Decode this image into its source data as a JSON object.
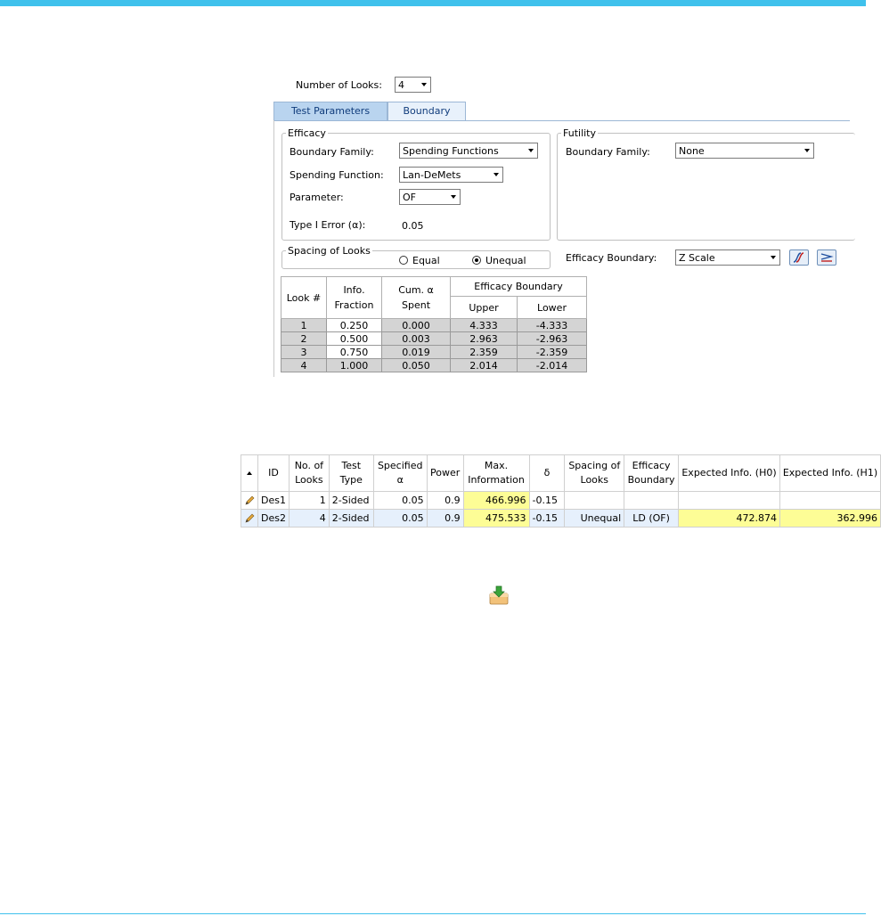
{
  "looks": {
    "label": "Number of Looks:",
    "value": "4"
  },
  "tabs": [
    {
      "label": "Test Parameters"
    },
    {
      "label": "Boundary"
    }
  ],
  "efficacy": {
    "group_label": "Efficacy",
    "boundary_family_label": "Boundary Family:",
    "boundary_family_value": "Spending Functions",
    "spending_function_label": "Spending Function:",
    "spending_function_value": "Lan-DeMets",
    "parameter_label": "Parameter:",
    "parameter_value": "OF",
    "type1_label": "Type I Error (α):",
    "type1_value": "0.05"
  },
  "futility": {
    "group_label": "Futility",
    "boundary_family_label": "Boundary Family:",
    "boundary_family_value": "None"
  },
  "spacing": {
    "group_label": "Spacing of Looks",
    "equal_label": "Equal",
    "unequal_label": "Unequal",
    "selected": "Unequal"
  },
  "efficacy_boundary": {
    "label": "Efficacy Boundary:",
    "value": "Z Scale"
  },
  "boundary_table": {
    "headers": {
      "look": "Look #",
      "info_fraction_1": "Info.",
      "info_fraction_2": "Fraction",
      "cum_alpha_1": "Cum. α",
      "cum_alpha_2": "Spent",
      "efficacy_boundary": "Efficacy Boundary",
      "upper": "Upper",
      "lower": "Lower"
    },
    "rows": [
      {
        "look": "1",
        "info": "0.250",
        "cum": "0.000",
        "upper": "4.333",
        "lower": "-4.333"
      },
      {
        "look": "2",
        "info": "0.500",
        "cum": "0.003",
        "upper": "2.963",
        "lower": "-2.963"
      },
      {
        "look": "3",
        "info": "0.750",
        "cum": "0.019",
        "upper": "2.359",
        "lower": "-2.359"
      },
      {
        "look": "4",
        "info": "1.000",
        "cum": "0.050",
        "upper": "2.014",
        "lower": "-2.014"
      }
    ]
  },
  "designs_table": {
    "headers": {
      "id": "ID",
      "looks_1": "No. of",
      "looks_2": "Looks",
      "test_1": "Test",
      "test_2": "Type",
      "alpha_1": "Specified",
      "alpha_2": "α",
      "power": "Power",
      "maxinfo_1": "Max.",
      "maxinfo_2": "Information",
      "delta": "δ",
      "spacing_1": "Spacing of",
      "spacing_2": "Looks",
      "eff_1": "Efficacy",
      "eff_2": "Boundary",
      "exp_h0": "Expected Info. (H0)",
      "exp_h1": "Expected Info. (H1)"
    },
    "rows": [
      {
        "id": "Des1",
        "looks": "1",
        "test": "2-Sided",
        "alpha": "0.05",
        "power": "0.9",
        "maxinfo": "466.996",
        "delta": "-0.15",
        "spacing": "",
        "eff": "",
        "exp_h0": "",
        "exp_h1": ""
      },
      {
        "id": "Des2",
        "looks": "4",
        "test": "2-Sided",
        "alpha": "0.05",
        "power": "0.9",
        "maxinfo": "475.533",
        "delta": "-0.15",
        "spacing": "Unequal",
        "eff": "LD (OF)",
        "exp_h0": "472.874",
        "exp_h1": "362.996"
      }
    ]
  },
  "colors": {
    "accent_bar": "#3fc1ec",
    "tab_active": "#b9d4ef",
    "highlight": "#fdfd96",
    "selected_row": "#e6f0fc"
  }
}
